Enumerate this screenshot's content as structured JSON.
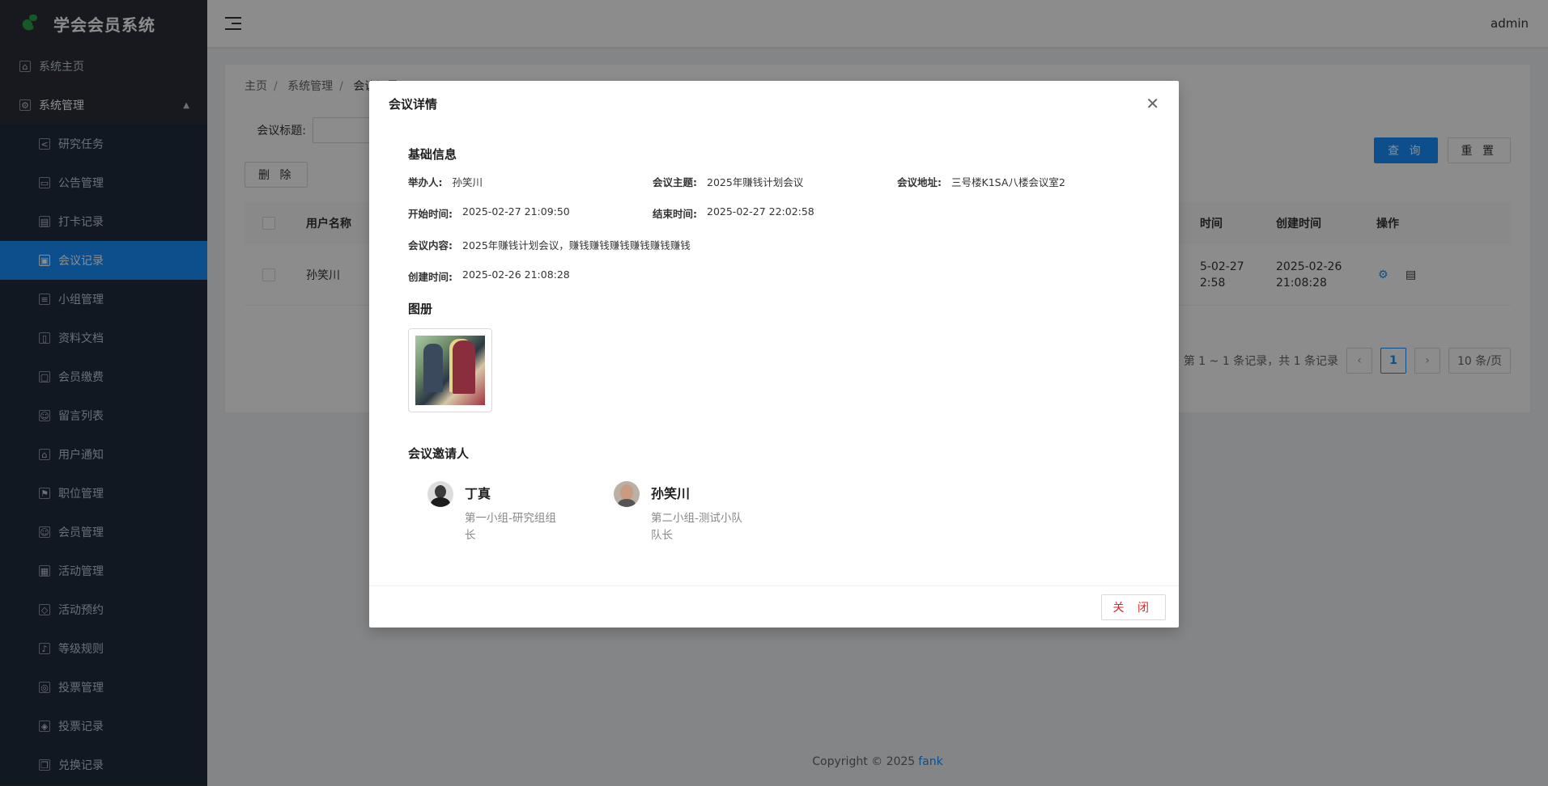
{
  "app": {
    "title": "学会会员系统",
    "user": "admin"
  },
  "sidebar": {
    "items": [
      {
        "label": "系统主页",
        "icon": "home-icon"
      },
      {
        "label": "系统管理",
        "icon": "settings-icon"
      },
      {
        "label": "研究任务",
        "icon": "share-icon"
      },
      {
        "label": "公告管理",
        "icon": "monitor-icon"
      },
      {
        "label": "打卡记录",
        "icon": "file-icon"
      },
      {
        "label": "会议记录",
        "icon": "image-icon"
      },
      {
        "label": "小组管理",
        "icon": "list-icon"
      },
      {
        "label": "资料文档",
        "icon": "document-icon"
      },
      {
        "label": "会员缴费",
        "icon": "lock-icon"
      },
      {
        "label": "留言列表",
        "icon": "user-icon"
      },
      {
        "label": "用户通知",
        "icon": "home-icon"
      },
      {
        "label": "职位管理",
        "icon": "flag-icon"
      },
      {
        "label": "会员管理",
        "icon": "user-icon"
      },
      {
        "label": "活动管理",
        "icon": "grid-icon"
      },
      {
        "label": "活动预约",
        "icon": "tag-icon"
      },
      {
        "label": "等级规则",
        "icon": "bell-icon"
      },
      {
        "label": "投票管理",
        "icon": "globe-icon"
      },
      {
        "label": "投票记录",
        "icon": "shield-icon"
      },
      {
        "label": "兑换记录",
        "icon": "copy-icon"
      }
    ]
  },
  "breadcrumb": [
    "主页",
    "系统管理",
    "会议记录"
  ],
  "search": {
    "label": "会议标题:",
    "query_btn": "查 询",
    "reset_btn": "重 置",
    "delete_btn": "删 除"
  },
  "table": {
    "headers": [
      "用户名称",
      "时间",
      "创建时间",
      "操作"
    ],
    "rows": [
      {
        "user": "孙笑川",
        "time_a": "5-02-27",
        "time_b": "2:58",
        "created_a": "2025-02-26",
        "created_b": "21:08:28"
      }
    ]
  },
  "pager": {
    "summary": "第 1 ~ 1 条记录，共 1 条记录",
    "page": "1",
    "size": "10 条/页"
  },
  "footer": {
    "copyright": "Copyright © 2025",
    "author": "fank"
  },
  "modal": {
    "title": "会议详情",
    "basic_title": "基础信息",
    "host_label": "举办人:",
    "host": "孙笑川",
    "topic_label": "会议主题:",
    "topic": "2025年赚钱计划会议",
    "addr_label": "会议地址:",
    "addr": "三号楼K1SA八楼会议室2",
    "start_label": "开始时间:",
    "start": "2025-02-27 21:09:50",
    "end_label": "结束时间:",
    "end": "2025-02-27 22:02:58",
    "content_label": "会议内容:",
    "content": "2025年赚钱计划会议，赚钱赚钱赚钱赚钱赚钱赚钱",
    "created_label": "创建时间:",
    "created": "2025-02-26 21:08:28",
    "album_title": "图册",
    "invitee_title": "会议邀请人",
    "invitees": [
      {
        "name": "丁真",
        "role": "第一小组-研究组组长"
      },
      {
        "name": "孙笑川",
        "role": "第二小组-测试小队队长"
      }
    ],
    "close_btn": "关 闭"
  }
}
